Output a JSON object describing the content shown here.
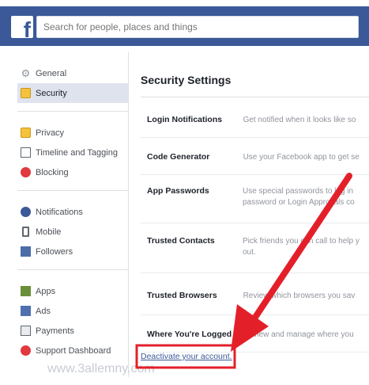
{
  "header": {
    "search_placeholder": "Search for people, places and things",
    "logo_letter": "f"
  },
  "sidebar": {
    "groups": [
      [
        {
          "label": "General",
          "icon": "gear-icon",
          "active": false
        },
        {
          "label": "Security",
          "icon": "lock-icon",
          "active": true
        }
      ],
      [
        {
          "label": "Privacy",
          "icon": "privacy-lock-icon",
          "active": false
        },
        {
          "label": "Timeline and Tagging",
          "icon": "timeline-icon",
          "active": false
        },
        {
          "label": "Blocking",
          "icon": "blocking-icon",
          "active": false
        }
      ],
      [
        {
          "label": "Notifications",
          "icon": "globe-icon",
          "active": false
        },
        {
          "label": "Mobile",
          "icon": "mobile-icon",
          "active": false
        },
        {
          "label": "Followers",
          "icon": "rss-icon",
          "active": false
        }
      ],
      [
        {
          "label": "Apps",
          "icon": "apps-icon",
          "active": false
        },
        {
          "label": "Ads",
          "icon": "ads-icon",
          "active": false
        },
        {
          "label": "Payments",
          "icon": "payments-icon",
          "active": false
        },
        {
          "label": "Support Dashboard",
          "icon": "support-icon",
          "active": false
        }
      ]
    ]
  },
  "main": {
    "title": "Security Settings",
    "rows": [
      {
        "label": "Login Notifications",
        "desc": "Get notified when it looks like so"
      },
      {
        "label": "Code Generator",
        "desc": "Use your Facebook app to get se"
      },
      {
        "label": "App Passwords",
        "desc": "Use special passwords to log in",
        "desc2": "password or Login Approvals co"
      },
      {
        "label": "Trusted Contacts",
        "desc": "Pick friends you can call to help y",
        "desc2": "out."
      },
      {
        "label": "Trusted Browsers",
        "desc": "Review which browsers you sav"
      },
      {
        "label": "Where You're Logged In",
        "desc": "Review and manage where you"
      }
    ],
    "deactivate_link": "Deactivate your account."
  },
  "watermark": "www.3allemny.com",
  "colors": {
    "brand_blue": "#3b5998",
    "arrow_red": "#e3202a",
    "active_bg": "#dfe3ee"
  }
}
